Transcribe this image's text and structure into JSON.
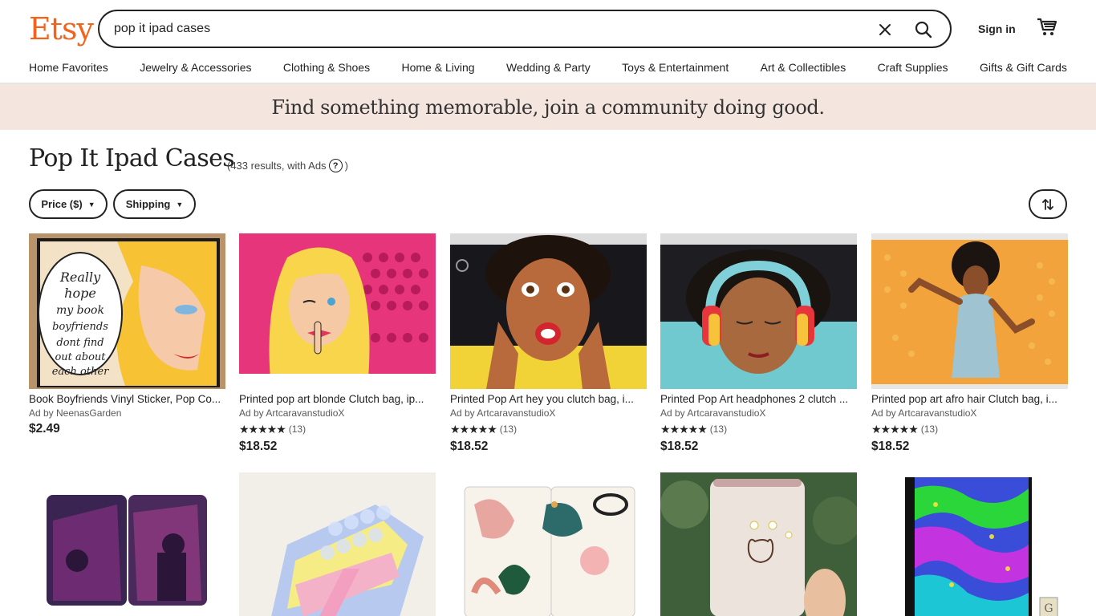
{
  "header": {
    "logo": "Etsy",
    "search_value": "pop it ipad cases",
    "signin_label": "Sign in"
  },
  "nav": [
    "Home Favorites",
    "Jewelry & Accessories",
    "Clothing & Shoes",
    "Home & Living",
    "Wedding & Party",
    "Toys & Entertainment",
    "Art & Collectibles",
    "Craft Supplies",
    "Gifts & Gift Cards"
  ],
  "banner": "Find something memorable, join a community doing good.",
  "results": {
    "title": "Pop It Ipad Cases",
    "count_prefix": "(433 results, with Ads",
    "count_suffix": ")"
  },
  "filters": {
    "price": "Price ($)",
    "shipping": "Shipping"
  },
  "listings": [
    {
      "title": "Book Boyfriends Vinyl Sticker, Pop Co...",
      "ad": "Ad by NeenasGarden",
      "price": "$2.49"
    },
    {
      "title": "Printed pop art blonde Clutch bag, ip...",
      "ad": "Ad by ArtcaravanstudioX",
      "stars": "★★★★★",
      "reviews": "(13)",
      "price": "$18.52"
    },
    {
      "title": "Printed Pop Art hey you clutch bag, i...",
      "ad": "Ad by ArtcaravanstudioX",
      "stars": "★★★★★",
      "reviews": "(13)",
      "price": "$18.52"
    },
    {
      "title": "Printed Pop Art headphones 2 clutch ...",
      "ad": "Ad by ArtcaravanstudioX",
      "stars": "★★★★★",
      "reviews": "(13)",
      "price": "$18.52"
    },
    {
      "title": "Printed pop art afro hair Clutch bag, i...",
      "ad": "Ad by ArtcaravanstudioX",
      "stars": "★★★★★",
      "reviews": "(13)",
      "price": "$18.52"
    }
  ],
  "colors": {
    "brand": "#f1641e",
    "banner_bg": "#f4e6df"
  }
}
